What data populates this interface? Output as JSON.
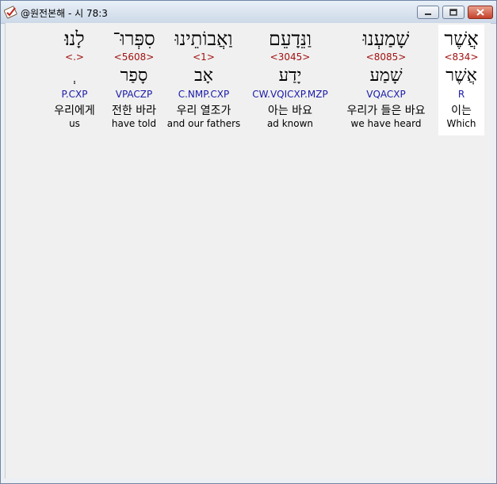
{
  "window": {
    "title": "@원전본해 - 시 78:3",
    "icons": {
      "app": "book-check-icon",
      "minimize": "minimize-icon",
      "maximize": "maximize-icon",
      "close": "close-icon"
    }
  },
  "words": [
    {
      "hebrew": "אֲשֶׁר",
      "strong": "<834>",
      "lemma": "אֲשֶׁר",
      "morph": "R",
      "korean": "이는",
      "english": "Which"
    },
    {
      "hebrew": "שָׁמַעְנוּ",
      "strong": "<8085>",
      "lemma": "שָׁמַע",
      "morph": "VQACXP",
      "korean": "우리가 들은 바요",
      "english": "we have heard"
    },
    {
      "hebrew": "וַנֵּדָעֵם",
      "strong": "<3045>",
      "lemma": "יָדַע",
      "morph": "CW.VQICXP.MZP",
      "korean": "아는 바요",
      "english": "ad known"
    },
    {
      "hebrew": "וַאֲבוֹתֵינוּ",
      "strong": "<1>",
      "lemma": "אָב",
      "morph": "C.NMP.CXP",
      "korean": "우리 열조가",
      "english": "and our fathers"
    },
    {
      "hebrew": "סִפְּרוּ־",
      "strong": "<5608>",
      "lemma": "סָפַר",
      "morph": "VPACZP",
      "korean": "전한 바라",
      "english": "have told"
    },
    {
      "hebrew": "לָנוּ׃",
      "strong": "<.>",
      "lemma": "ְ",
      "morph": "P.CXP",
      "korean": "우리에게",
      "english": "us"
    }
  ]
}
